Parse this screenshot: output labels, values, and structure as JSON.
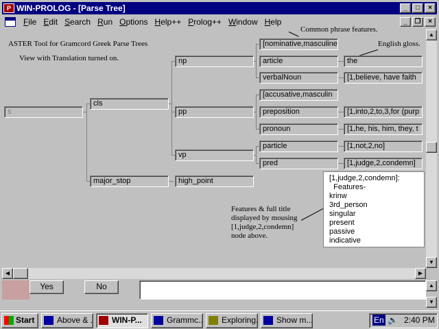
{
  "window": {
    "title": "WIN-PROLOG - [Parse Tree]",
    "app_icon": "P",
    "buttons": [
      "_",
      "□",
      "×"
    ]
  },
  "menu": {
    "items": [
      "File",
      "Edit",
      "Search",
      "Run",
      "Options",
      "Help++",
      "Prolog++",
      "Window",
      "Help"
    ],
    "mdi_buttons": [
      "_",
      "❐",
      "×"
    ]
  },
  "notes": {
    "heading": "ASTER Tool for Gramcord Greek Parse Trees",
    "subheading": "View with Translation turned on.",
    "common_features": "Common phrase features.",
    "english_gloss": "English gloss.",
    "mouse_note": [
      "Features & full title",
      "displayed by mousing",
      "[1,judge,2,condemn]",
      "node above."
    ]
  },
  "tree": {
    "root": "s",
    "cls": "cls",
    "np": "np",
    "pp": "pp",
    "vp": "vp",
    "major_stop": "major_stop",
    "high_point": "high_point",
    "np_features": "[nominative,masculine",
    "article": "article",
    "article_gloss": "the",
    "verbalNoun": "verbalNoun",
    "verbalNoun_gloss": "[1,believe, have faith",
    "pp_features": "[accusative,masculin",
    "preposition": "preposition",
    "preposition_gloss": "[1,into,2,to,3,for (purp",
    "pronoun": "pronoun",
    "pronoun_gloss": "[1,he, his, him, they, t",
    "particle": "particle",
    "particle_gloss": "[1,not,2,no]",
    "pred": "pred",
    "pred_gloss": "[1,judge,2,condemn]"
  },
  "popup": {
    "lines": [
      "[1,judge,2,condemn]:",
      "  Features-",
      "krinw",
      "3rd_person",
      "singular",
      "present",
      "passive",
      "indicative"
    ]
  },
  "bottom": {
    "yes": "Yes",
    "no": "No"
  },
  "taskbar": {
    "start": "Start",
    "tasks": [
      "Above & ...",
      "WIN-P...",
      "Grammc...",
      "Exploring...",
      "Show m..."
    ],
    "lang": "En",
    "time": "2:40 PM"
  },
  "colors": {
    "titlebar": "#000080",
    "face": "#c0c0c0",
    "line": "#808080"
  }
}
